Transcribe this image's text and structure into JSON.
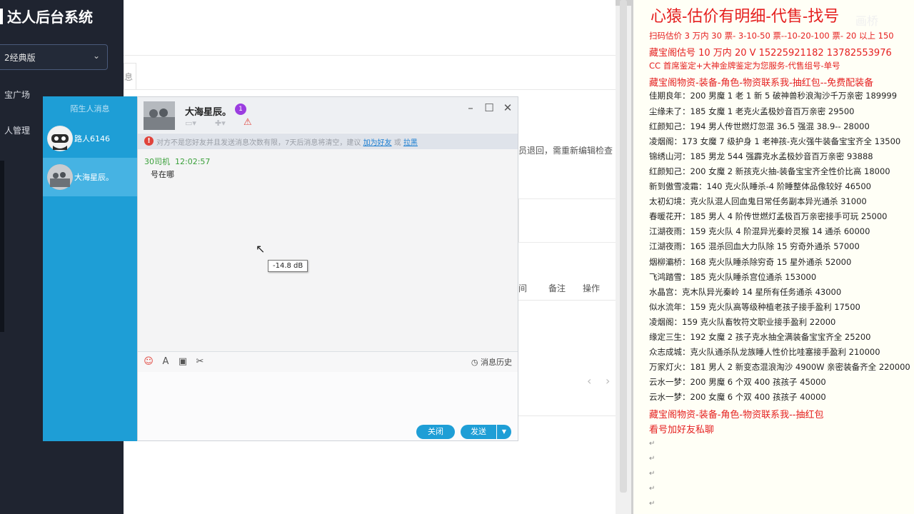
{
  "sidebar": {
    "brand": "达人后台系统",
    "version_select": "2经典版",
    "nav": [
      "宝广场",
      "人管理"
    ]
  },
  "background": {
    "tab_fragment": "息",
    "notice_fragment": "员退回，需重新编辑检查",
    "table_headers": [
      "间",
      "备注",
      "操作"
    ],
    "pager": [
      "‹",
      "›"
    ]
  },
  "chat_sidebar": {
    "header": "陌生人消息",
    "contacts": [
      {
        "name": "路人6146"
      },
      {
        "name": "大海星辰。"
      }
    ]
  },
  "chat": {
    "contact_name": "大海星辰。",
    "badge": "1",
    "notice": {
      "text": "对方不是您好友并且发送消息次数有限，7天后消息将清空，建议",
      "link_add": "加为好友",
      "or": "或",
      "link_block": "拉黑"
    },
    "messages": [
      {
        "sender": "30司机",
        "time": "12:02:57",
        "text": "号在哪"
      }
    ],
    "tooltip": "-14.8 dB",
    "history_label": "消息历史",
    "close_label": "关闭",
    "send_label": "发送"
  },
  "right_panel": {
    "title": "心猿-估价有明细-代售-找号",
    "lines": [
      {
        "text": "扫码估价 3 万内 30 票- 3-10-50 票--10-20-100 票- 20 以上 150",
        "red": true
      },
      {
        "text": "藏宝阁估号 10 万内 20 V 15225921182   13782553976",
        "red": true,
        "big": true
      },
      {
        "text": "CC 首席鉴定+大神金牌鉴定为您服务-代售组号-单号",
        "red": true
      },
      {
        "text": "藏宝阁物资-装备-角色-物资联系我-抽红包--免费配装备",
        "red": true,
        "big": true
      },
      {
        "text": "佳期良年：200 男魔 1 老 1 新 5 破神兽秒浪淘沙千万亲密 189999"
      },
      {
        "text": "尘缘未了：185 女魔 1 老克火孟极妙音百万亲密 29500"
      },
      {
        "text": "红颜知己：194 男人传世燃灯忽混 36.5 强混 38.9-- 28000"
      },
      {
        "text": "凌烟阁：173 女魔 7 级护身 1 老神孩-克火强牛装备宝宝齐全 13500"
      },
      {
        "text": "锦绣山河：185 男龙 544 强霹克水孟极妙音百万亲密 93888"
      },
      {
        "text": "红颜知己：200 女魔 2 新孩克火抽-装备宝宝齐全性价比高 18000"
      },
      {
        "text": "新到傲雪凌霜：140 克火队睡杀-4 阶睡整体品像较好 46500"
      },
      {
        "text": "太初幻境：克火队混人回血鬼日常任务副本异光通杀 31000"
      },
      {
        "text": "春暖花开：185 男人 4 阶传世燃灯孟极百万亲密接手可玩 25000"
      },
      {
        "text": "江湖夜雨：159 克火队 4 阶混异光秦岭灵猴 14 通杀 60000"
      },
      {
        "text": "江湖夜雨：165 混杀回血大力队除 15 穷奇外通杀 57000"
      },
      {
        "text": "烟柳灞桥：168 克火队睡杀除穷奇 15 星外通杀 52000"
      },
      {
        "text": "飞鸿踏雪：185 克火队睡杀宫位通杀 153000"
      },
      {
        "text": "水晶宫：克木队异光秦岭 14 星所有任务通杀 43000"
      },
      {
        "text": "似水流年：159 克火队高等级种植老孩子接手盈利 17500"
      },
      {
        "text": "凌烟阁：159 克火队畜牧符文职业接手盈利 22000"
      },
      {
        "text": "缘定三生：192 女魔 2 孩子克水抽全满装备宝宝齐全 25200"
      },
      {
        "text": "众志成城：克火队通杀队龙族睡人性价比哇塞接手盈利 210000"
      },
      {
        "text": "万家灯火：181 男人 2 新变态混浪淘沙 4900W 亲密装备齐全 220000"
      },
      {
        "text": "云水一梦：200 男魔 6 个双 400 孩孩子 45000"
      },
      {
        "text": "云水一梦：200 女魔 6 个双 400 孩孩子 40000"
      },
      {
        "text": "藏宝阁物资-装备-角色-物资联系我--抽红包",
        "red": true,
        "big": true
      },
      {
        "text": "看号加好友私聊",
        "red": true,
        "big": true
      }
    ],
    "watermark": "画桥"
  },
  "colors": {
    "sidebar_bg": "#1f2430",
    "chat_accent": "#1e9ed6",
    "link": "#1d7fd1",
    "red_text": "#e52020",
    "sender_green": "#3aa03a"
  }
}
